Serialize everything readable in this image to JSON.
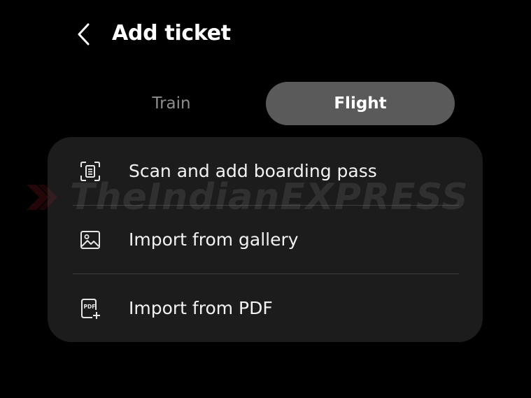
{
  "header": {
    "title": "Add ticket",
    "back_icon": "chevron-left-icon"
  },
  "tabs": [
    {
      "label": "Train",
      "selected": false
    },
    {
      "label": "Flight",
      "selected": true
    }
  ],
  "menu": {
    "items": [
      {
        "label": "Scan and add boarding pass",
        "icon": "scan-document-icon"
      },
      {
        "label": "Import from gallery",
        "icon": "image-icon"
      },
      {
        "label": "Import from PDF",
        "icon": "pdf-add-icon"
      }
    ]
  },
  "watermark": {
    "text": "TheIndianEXPRESS"
  },
  "colors": {
    "background": "#000000",
    "card": "#1c1c1c",
    "selected_tab": "#5a5a5a",
    "unselected_tab_text": "#8e8e8e",
    "divider": "#3d3d3d",
    "watermark_red": "#c0262d"
  }
}
